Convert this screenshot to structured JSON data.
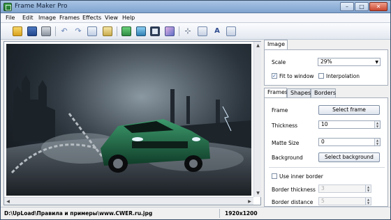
{
  "window": {
    "title": "Frame Maker Pro"
  },
  "menu": [
    "File",
    "Edit",
    "Image",
    "Frames",
    "Effects",
    "View",
    "Help"
  ],
  "toolbar": {
    "icons": [
      "open-icon",
      "save-icon",
      "print-icon",
      "undo-icon",
      "redo-icon",
      "copy-icon",
      "paste-icon",
      "image-tool-icon",
      "picture-icon",
      "frame-icon",
      "brush-icon",
      "crop-icon",
      "resize-icon",
      "text-icon",
      "document-icon"
    ]
  },
  "image_panel": {
    "tab": "Image",
    "scale_label": "Scale",
    "scale_value": "29%",
    "fit_to_window": {
      "label": "Fit to window",
      "checked": true
    },
    "interpolation": {
      "label": "Interpolation",
      "checked": false
    }
  },
  "tabs": [
    "Frames",
    "Shapes",
    "Borders"
  ],
  "frames": {
    "frame_label": "Frame",
    "select_frame": "Select frame",
    "thickness_label": "Thickness",
    "thickness_value": "10",
    "matte_label": "Matte Size",
    "matte_value": "0",
    "background_label": "Background",
    "select_background": "Select background",
    "inner_border": {
      "label": "Use inner border",
      "checked": false
    },
    "border_thickness_label": "Border thickness",
    "border_thickness_value": "3",
    "border_distance_label": "Border distance",
    "border_distance_value": "5"
  },
  "status": {
    "path": "D:\\UpLoad\\Правила и примеры\\www.CWER.ru.jpg",
    "dimensions": "1920x1200"
  },
  "colors": {
    "accent": "#7fa3cf",
    "car": "#1f6a45"
  }
}
